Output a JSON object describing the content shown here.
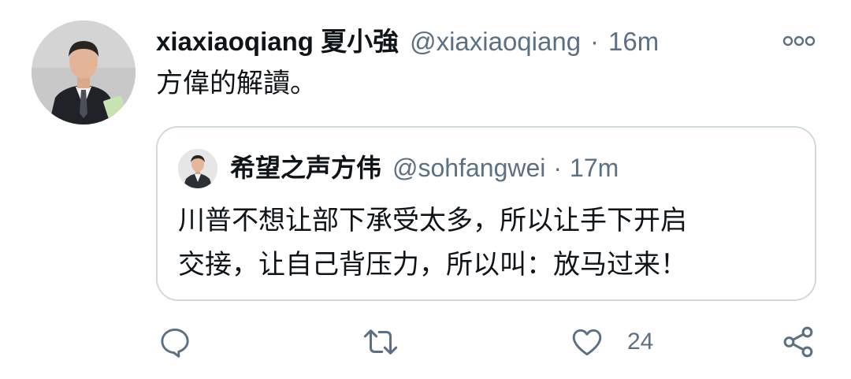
{
  "tweet": {
    "display_name": "xiaxiaoqiang 夏小強",
    "handle": "@xiaxiaoqiang",
    "separator": "·",
    "time": "16m",
    "text": "方偉的解讀。"
  },
  "quoted_tweet": {
    "display_name": "希望之声方伟",
    "handle": "@sohfangwei",
    "separator": "·",
    "time": "17m",
    "text_lines": [
      "川普不想让部下承受太多，所以让手下开启",
      "交接，让自己背压力，所以叫：放马过来！"
    ]
  },
  "actions": {
    "reply_icon": "reply-icon",
    "retweet_icon": "retweet-icon",
    "like_icon": "heart-icon",
    "like_count": "24",
    "share_icon": "share-icon"
  },
  "colors": {
    "text_primary": "#0f1419",
    "text_secondary": "#5b7083",
    "border": "#cfd9de"
  }
}
